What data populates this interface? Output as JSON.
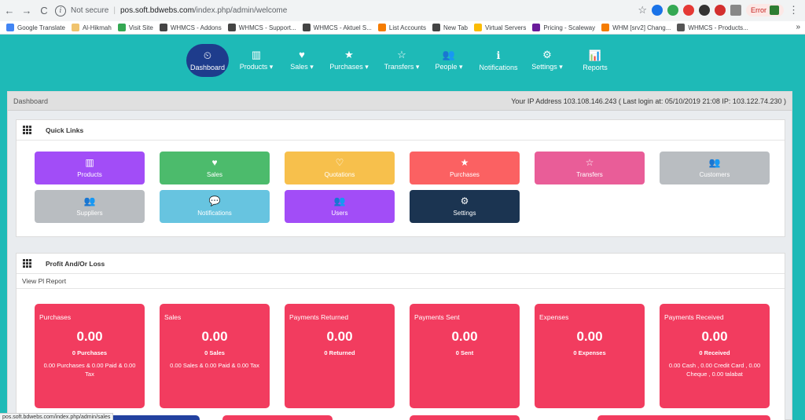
{
  "browser": {
    "back": "←",
    "forward": "→",
    "reload": "C",
    "info_glyph": "i",
    "not_secure": "Not secure",
    "separator": "|",
    "url_host": "pos.soft.bdwebs.com",
    "url_path": "/index.php/admin/welcome",
    "error_label": "Error",
    "star": "☆",
    "menu": "⋮"
  },
  "bookmarks": [
    {
      "label": "Google Translate",
      "color": "#4285f4"
    },
    {
      "label": "Al-Hikmah",
      "color": "#f0c36d"
    },
    {
      "label": "Visit Site",
      "color": "#34a853"
    },
    {
      "label": "WHMCS - Addons",
      "color": "#444444"
    },
    {
      "label": "WHMCS - Support...",
      "color": "#444444"
    },
    {
      "label": "WHMCS - Aktuel S...",
      "color": "#444444"
    },
    {
      "label": "List Accounts",
      "color": "#f57c00"
    },
    {
      "label": "New Tab",
      "color": "#444444"
    },
    {
      "label": "Virtual Servers",
      "color": "#fbbc05"
    },
    {
      "label": "Pricing - Scaleway",
      "color": "#6a1b9a"
    },
    {
      "label": "WHM [srv2] Chang...",
      "color": "#f57c00"
    },
    {
      "label": "WHMCS - Products..."
    }
  ],
  "bookmarks_more": "»",
  "nav": [
    {
      "label": "Dashboard",
      "icon": "⏲",
      "active": true
    },
    {
      "label": "Products ▾",
      "icon": "▥"
    },
    {
      "label": "Sales ▾",
      "icon": "♥"
    },
    {
      "label": "Purchases ▾",
      "icon": "★"
    },
    {
      "label": "Transfers ▾",
      "icon": "☆"
    },
    {
      "label": "People ▾",
      "icon": "👥"
    },
    {
      "label": "Notifications",
      "icon": "ℹ"
    },
    {
      "label": "Settings ▾",
      "icon": "⚙"
    },
    {
      "label": "Reports",
      "icon": "📊"
    }
  ],
  "header": {
    "breadcrumb": "Dashboard",
    "ip_info": "Your IP Address 103.108.146.243 ( Last login at: 05/10/2019 21:08 IP: 103.122.74.230 )"
  },
  "quick_links": {
    "title": "Quick Links",
    "items": [
      {
        "label": "Products",
        "icon": "▥",
        "color": "#a24df7"
      },
      {
        "label": "Sales",
        "icon": "♥",
        "color": "#4cbb6c"
      },
      {
        "label": "Quotations",
        "icon": "♡",
        "color": "#f7c04c"
      },
      {
        "label": "Purchases",
        "icon": "★",
        "color": "#fb6162"
      },
      {
        "label": "Transfers",
        "icon": "☆",
        "color": "#e95d98"
      },
      {
        "label": "Customers",
        "icon": "👥",
        "color": "#b9bdc1"
      },
      {
        "label": "Suppliers",
        "icon": "👥",
        "color": "#b9bdc1"
      },
      {
        "label": "Notifications",
        "icon": "💬",
        "color": "#67c4e0"
      },
      {
        "label": "Users",
        "icon": "👥",
        "color": "#a24df7"
      },
      {
        "label": "Settings",
        "icon": "⚙",
        "color": "#1b3451"
      }
    ]
  },
  "profit": {
    "title": "Profit And/Or Loss",
    "link": "View Pl Report",
    "cards": [
      {
        "title": "Purchases",
        "value": "0.00",
        "count": "0 Purchases",
        "detail": "0.00 Purchases & 0.00 Paid & 0.00 Tax"
      },
      {
        "title": "Sales",
        "value": "0.00",
        "count": "0 Sales",
        "detail": "0.00 Sales & 0.00 Paid & 0.00 Tax"
      },
      {
        "title": "Payments Returned",
        "value": "0.00",
        "count": "0 Returned",
        "detail": ""
      },
      {
        "title": "Payments Sent",
        "value": "0.00",
        "count": "0 Sent",
        "detail": ""
      },
      {
        "title": "Expenses",
        "value": "0.00",
        "count": "0 Expenses",
        "detail": ""
      },
      {
        "title": "Payments Received",
        "value": "0.00",
        "count": "0 Received",
        "detail": "0.00 Cash , 0.00 Credit Card , 0.00 Cheque , 0.00 talabat"
      }
    ]
  },
  "status_url": "pos.soft.bdwebs.com/index.php/admin/sales"
}
